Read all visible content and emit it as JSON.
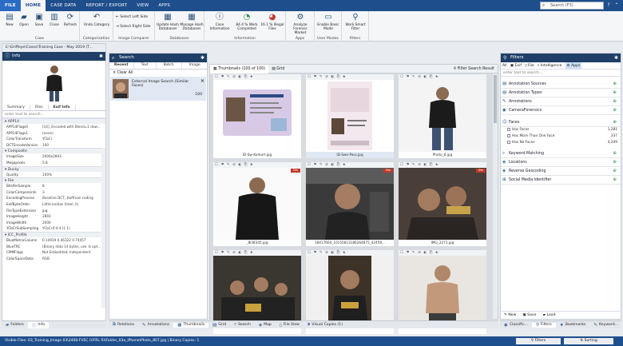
{
  "menubar": {
    "tabs": [
      "FILE",
      "HOME",
      "CASE DATA",
      "REPORT / EXPORT",
      "VIEW",
      "APPS"
    ],
    "search_placeholder": "Search (F3)"
  },
  "ribbon": {
    "case": {
      "label": "Case",
      "buttons": [
        "New",
        "Open",
        "Save",
        "Close",
        "Refresh"
      ]
    },
    "categorization": {
      "label": "Categorization",
      "button": "Undo Category"
    },
    "comparer": {
      "label": "Image Comparer",
      "select_left": "Select Left Side",
      "select_right": "Select Right Side"
    },
    "databases": {
      "label": "Databases",
      "update": "Update Hash Databases",
      "manage": "Manage Hash Databases"
    },
    "information": {
      "label": "Information",
      "case_info": "Case Information",
      "work": "84.4 % Work Completed",
      "illegal": "16.1 % Illegal Files"
    },
    "apps": {
      "label": "Apps",
      "analyze": "Analyze Forensic Market"
    },
    "usermodes": {
      "label": "User Modes",
      "basic": "Enable Basic Mode"
    },
    "filters": {
      "label": "Filters",
      "smart": "Work Smart Filter"
    }
  },
  "info_panel": {
    "path": "E:\\Griffeye\\Cases\\Training Case - May 2019 (T...",
    "title": "Info",
    "tabs": [
      "Summary",
      "Files",
      "Exif Info"
    ],
    "filter_placeholder": "enter text to search...",
    "sections": [
      {
        "name": "APP14",
        "rows": [
          [
            "APP14Flags0",
            "[14], Encoded with Blend=1 dow..."
          ],
          [
            "APP14Flags1",
            "(none)"
          ],
          [
            "ColorTransform",
            "YCbCr"
          ],
          [
            "DCTEncodeVersion",
            "100"
          ]
        ]
      },
      {
        "name": "Composite",
        "rows": [
          [
            "ImageSize",
            "2000x2893"
          ],
          [
            "Megapixels",
            "5.8"
          ]
        ]
      },
      {
        "name": "Ducky",
        "rows": [
          [
            "Quality",
            "100%"
          ]
        ]
      },
      {
        "name": "File",
        "rows": [
          [
            "BitsPerSample",
            "8"
          ],
          [
            "ColorComponents",
            "3"
          ],
          [
            "EncodingProcess",
            "Baseline DCT, Huffman coding"
          ],
          [
            "ExifByteOrder",
            "Little-endian (Intel, II)"
          ],
          [
            "FileTypeExtension",
            "jpg"
          ],
          [
            "ImageHeight",
            "2893"
          ],
          [
            "ImageWidth",
            "2000"
          ],
          [
            "YCbCrSubSampling",
            "YCbCr4:4:4 (1 1)"
          ]
        ]
      },
      {
        "name": "ICC_Profile",
        "rows": [
          [
            "BlueMatrixColumn",
            "0.14919 0.06322 0.74457"
          ],
          [
            "BlueTRC",
            "(Binary data 14 bytes, use -b opt..."
          ],
          [
            "CMMFlags",
            "Not Embedded, Independent"
          ],
          [
            "ColorSpaceData",
            "RGB"
          ]
        ]
      }
    ]
  },
  "search_panel": {
    "title": "Search",
    "tabs": [
      "Recent",
      "Text",
      "Batch",
      "Image"
    ],
    "clear": "Clear All",
    "result": {
      "label": "External Image Search (Similar Faces)",
      "count": "100"
    }
  },
  "thumbnails": {
    "tabs": [
      "Thumbnails (100 of 100)",
      "Grid"
    ],
    "filter_label": "Filter Search Result",
    "cells": [
      {
        "caption": "ID-Sw-Korkort.jpg",
        "tag": ""
      },
      {
        "caption": "ID-Swe-Pass.jpg",
        "tag": ""
      },
      {
        "caption": "Photo_8.jpg",
        "tag": ""
      },
      {
        "caption": "_8l38345.jpg",
        "tag": "Sim"
      },
      {
        "caption": "18417664_10155813186264875_42459...",
        "tag": "Sim"
      },
      {
        "caption": "IMG_2271.jpg",
        "tag": "Sim"
      },
      {
        "caption": "",
        "tag": ""
      },
      {
        "caption": "",
        "tag": ""
      },
      {
        "caption": "",
        "tag": ""
      }
    ]
  },
  "filters_panel": {
    "title": "Filters",
    "tabs": [
      "All",
      "Exif",
      "File",
      "Intelligence",
      "Apps"
    ],
    "filter_placeholder": "enter text to search...",
    "sections": [
      "Annotation Sources",
      "Annotation Types",
      "Annotations",
      "CameraForensics",
      "Faces",
      "Keyword Matching",
      "Locations",
      "Reverse Geocoding",
      "Social Media Identifier"
    ],
    "faces_rows": [
      [
        "Has Faces",
        "1,281"
      ],
      [
        "Has More Than One Face",
        "337"
      ],
      [
        "Has No Faces",
        "4,209"
      ]
    ],
    "actions": [
      "New",
      "Save",
      "Load"
    ]
  },
  "bottom_left_tabs": [
    "Folders",
    "Info"
  ],
  "bottom_center_tabs": [
    "Relations",
    "Annotations",
    "Thumbnails",
    "Grid",
    "Search",
    "Map",
    "File View",
    "Visual Copies (1)"
  ],
  "bottom_right_tabs": [
    "Classific...",
    "Filters",
    "Bookmarks",
    "Keyword..."
  ],
  "statusbar": {
    "text": "Visible Files: 03_Training_Image 03\\2408-FVEC (VFRL 9)\\Folder_03a_iPhone\\Photo_807.jpg | Binary Copies: 1",
    "filters": "Filters",
    "sorting": "Sorting"
  }
}
